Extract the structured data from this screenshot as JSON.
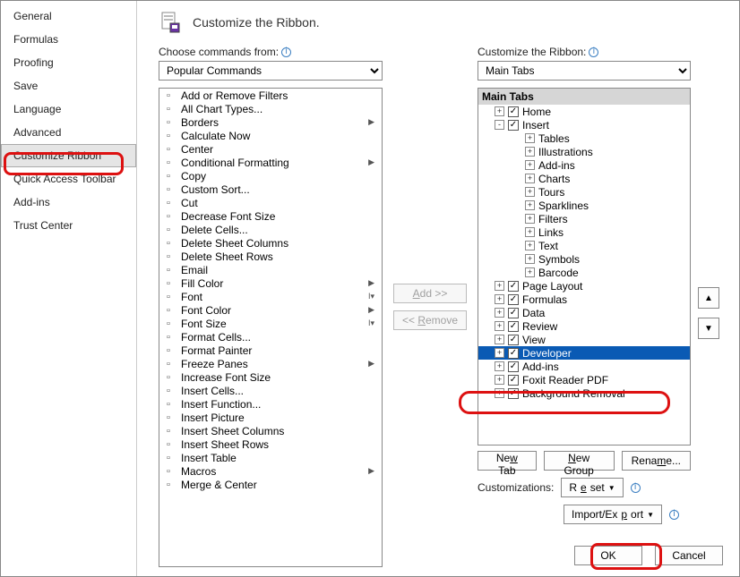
{
  "sidebar": {
    "items": [
      {
        "label": "General"
      },
      {
        "label": "Formulas"
      },
      {
        "label": "Proofing"
      },
      {
        "label": "Save"
      },
      {
        "label": "Language"
      },
      {
        "label": "Advanced"
      },
      {
        "label": "Customize Ribbon",
        "selected": true
      },
      {
        "label": "Quick Access Toolbar"
      },
      {
        "label": "Add-ins"
      },
      {
        "label": "Trust Center"
      }
    ]
  },
  "header": {
    "title": "Customize the Ribbon."
  },
  "left": {
    "label": "Choose commands from:",
    "combo": "Popular Commands",
    "commands": [
      {
        "label": "Add or Remove Filters"
      },
      {
        "label": "All Chart Types..."
      },
      {
        "label": "Borders",
        "arrow": true
      },
      {
        "label": "Calculate Now"
      },
      {
        "label": "Center"
      },
      {
        "label": "Conditional Formatting",
        "arrow": true
      },
      {
        "label": "Copy"
      },
      {
        "label": "Custom Sort..."
      },
      {
        "label": "Cut"
      },
      {
        "label": "Decrease Font Size"
      },
      {
        "label": "Delete Cells..."
      },
      {
        "label": "Delete Sheet Columns"
      },
      {
        "label": "Delete Sheet Rows"
      },
      {
        "label": "Email"
      },
      {
        "label": "Fill Color",
        "arrow": true
      },
      {
        "label": "Font",
        "combo": true
      },
      {
        "label": "Font Color",
        "arrow": true
      },
      {
        "label": "Font Size",
        "combo": true
      },
      {
        "label": "Format Cells..."
      },
      {
        "label": "Format Painter"
      },
      {
        "label": "Freeze Panes",
        "arrow": true
      },
      {
        "label": "Increase Font Size"
      },
      {
        "label": "Insert Cells..."
      },
      {
        "label": "Insert Function..."
      },
      {
        "label": "Insert Picture"
      },
      {
        "label": "Insert Sheet Columns"
      },
      {
        "label": "Insert Sheet Rows"
      },
      {
        "label": "Insert Table"
      },
      {
        "label": "Macros",
        "arrow": true
      },
      {
        "label": "Merge & Center"
      }
    ]
  },
  "mid": {
    "add": "Add >>",
    "remove": "<< Remove"
  },
  "right": {
    "label": "Customize the Ribbon:",
    "combo": "Main Tabs",
    "treeHeader": "Main Tabs",
    "nodes": [
      {
        "type": "tab",
        "label": "Home",
        "expander": "+",
        "checked": true
      },
      {
        "type": "tab",
        "label": "Insert",
        "expander": "-",
        "checked": true
      },
      {
        "type": "group",
        "label": "Tables"
      },
      {
        "type": "group",
        "label": "Illustrations"
      },
      {
        "type": "group",
        "label": "Add-ins"
      },
      {
        "type": "group",
        "label": "Charts"
      },
      {
        "type": "group",
        "label": "Tours"
      },
      {
        "type": "group",
        "label": "Sparklines"
      },
      {
        "type": "group",
        "label": "Filters"
      },
      {
        "type": "group",
        "label": "Links"
      },
      {
        "type": "group",
        "label": "Text"
      },
      {
        "type": "group",
        "label": "Symbols"
      },
      {
        "type": "group",
        "label": "Barcode"
      },
      {
        "type": "tab",
        "label": "Page Layout",
        "expander": "+",
        "checked": true
      },
      {
        "type": "tab",
        "label": "Formulas",
        "expander": "+",
        "checked": true
      },
      {
        "type": "tab",
        "label": "Data",
        "expander": "+",
        "checked": true
      },
      {
        "type": "tab",
        "label": "Review",
        "expander": "+",
        "checked": true
      },
      {
        "type": "tab",
        "label": "View",
        "expander": "+",
        "checked": true
      },
      {
        "type": "tab",
        "label": "Developer",
        "expander": "+",
        "checked": true,
        "selected": true
      },
      {
        "type": "tab",
        "label": "Add-ins",
        "expander": "+",
        "checked": true
      },
      {
        "type": "tab",
        "label": "Foxit Reader PDF",
        "expander": "+",
        "checked": true
      },
      {
        "type": "tab",
        "label": "Background Removal",
        "expander": "+",
        "checked": true
      }
    ],
    "newTab": "New Tab",
    "newGroup": "New Group",
    "rename": "Rename...",
    "customizations": "Customizations:",
    "reset": "Reset",
    "importExport": "Import/Export"
  },
  "footer": {
    "ok": "OK",
    "cancel": "Cancel"
  }
}
